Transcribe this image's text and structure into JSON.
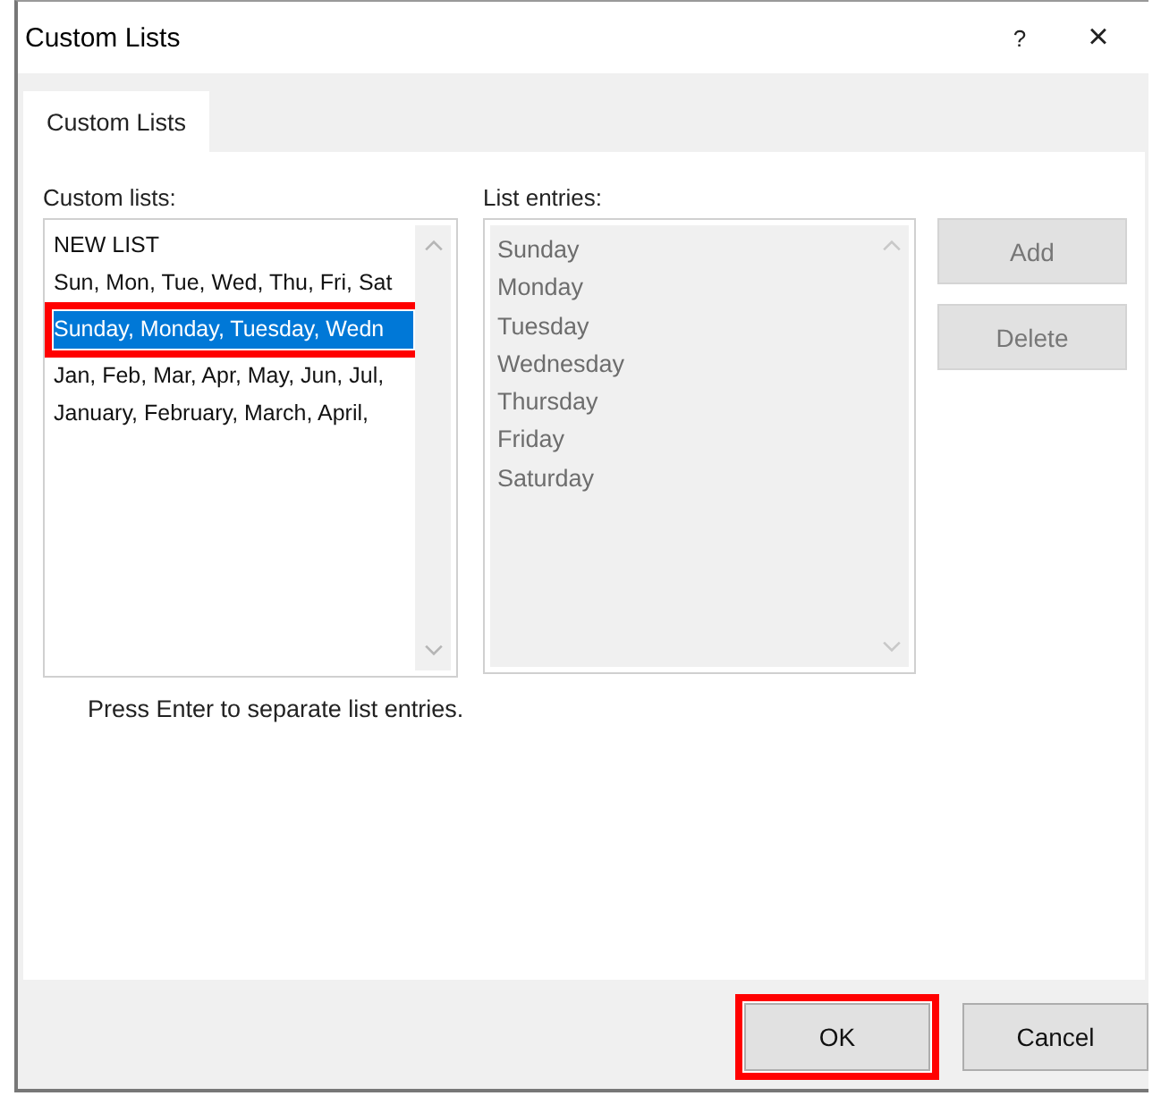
{
  "window": {
    "title": "Custom Lists",
    "help_button": "?",
    "close_button": "×"
  },
  "tabs": [
    {
      "label": "Custom Lists",
      "selected": true
    }
  ],
  "custom_lists": {
    "label": "Custom lists:",
    "items": [
      {
        "text": "NEW LIST",
        "selected": false,
        "highlighted": false
      },
      {
        "text": "Sun, Mon, Tue, Wed, Thu, Fri, Sat",
        "selected": false,
        "highlighted": false
      },
      {
        "text": "Sunday, Monday, Tuesday, Wedn",
        "selected": true,
        "highlighted": true
      },
      {
        "text": "Jan, Feb, Mar, Apr, May, Jun, Jul,",
        "selected": false,
        "highlighted": false
      },
      {
        "text": "January, February, March, April,",
        "selected": false,
        "highlighted": false
      }
    ]
  },
  "list_entries": {
    "label": "List entries:",
    "disabled": true,
    "entries": [
      "Sunday",
      "Monday",
      "Tuesday",
      "Wednesday",
      "Thursday",
      "Friday",
      "Saturday"
    ]
  },
  "side_buttons": [
    {
      "label": "Add",
      "disabled": true
    },
    {
      "label": "Delete",
      "disabled": true
    }
  ],
  "hint": "Press Enter to separate list entries.",
  "buttons": [
    {
      "label": "OK",
      "highlighted": true
    },
    {
      "label": "Cancel",
      "highlighted": false
    }
  ]
}
